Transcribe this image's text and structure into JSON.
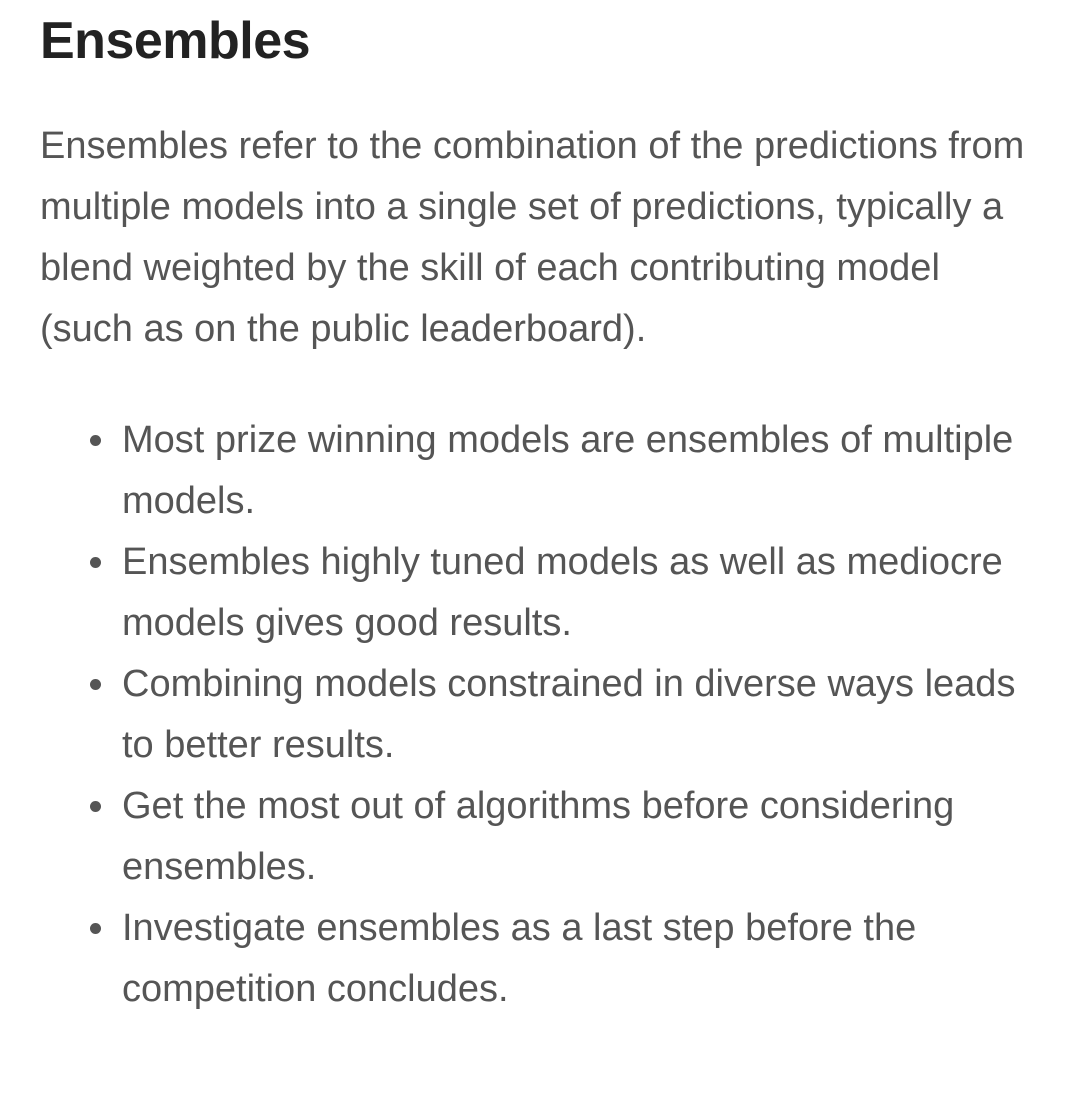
{
  "article": {
    "heading": "Ensembles",
    "intro": "Ensembles refer to the combination of the predictions from multiple models into a single set of predictions, typically a blend weighted by the skill of each contributing model (such as on the public leaderboard).",
    "bullets": [
      "Most prize winning models are ensembles of multiple models.",
      "Ensembles highly tuned models as well as mediocre models gives good results.",
      "Combining models constrained in diverse ways leads to better results.",
      "Get the most out of algorithms before considering ensembles.",
      "Investigate ensembles as a last step before the competition concludes."
    ]
  },
  "colors": {
    "heading": "#222222",
    "body_text": "#555555",
    "background": "#ffffff"
  }
}
